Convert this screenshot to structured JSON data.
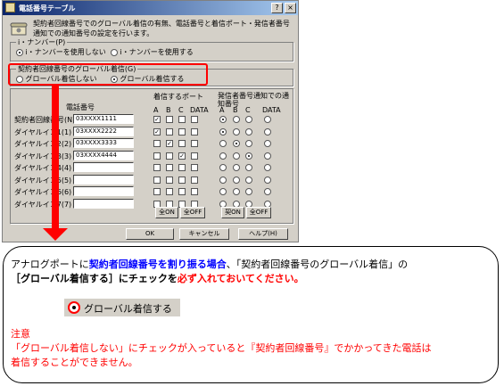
{
  "window": {
    "title": "電話番号テーブル",
    "description": "契約者回線番号でのグローバル着信の有無、電話番号と着信ポート・発信者番号通知での通知番号の設定を行います。",
    "inumber_group": {
      "label": "i・ナンバー(P)",
      "options": [
        "i・ナンバーを使用しない",
        "i・ナンバーを使用する"
      ],
      "selected": 0
    },
    "global_group": {
      "label": "契約者回線番号のグローバル着信(G)",
      "options": [
        "グローバル着信しない",
        "グローバル着信する"
      ],
      "selected": 1
    },
    "table": {
      "col_number": "電話番号",
      "col_ports": "着信するポート",
      "col_notify": "発信者番号通知での通知番号",
      "port_letters": [
        "A",
        "B",
        "C",
        "DATA"
      ],
      "rows": [
        {
          "label": "契約者回線番号(N)",
          "number": "03XXXX1111",
          "ports": [
            true,
            false,
            false,
            false
          ],
          "notify": 0
        },
        {
          "label": "ダイヤルイン1(1)",
          "number": "03XXXX2222",
          "ports": [
            true,
            false,
            false,
            false
          ],
          "notify": 0
        },
        {
          "label": "ダイヤルイン2(2)",
          "number": "03XXXX3333",
          "ports": [
            false,
            true,
            false,
            false
          ],
          "notify": 1
        },
        {
          "label": "ダイヤルイン3(3)",
          "number": "03XXXX4444",
          "ports": [
            false,
            false,
            true,
            false
          ],
          "notify": 2
        },
        {
          "label": "ダイヤルイン4(4)",
          "number": "",
          "ports": [
            false,
            false,
            false,
            false
          ],
          "notify": -1
        },
        {
          "label": "ダイヤルイン5(5)",
          "number": "",
          "ports": [
            false,
            false,
            false,
            false
          ],
          "notify": -1
        },
        {
          "label": "ダイヤルイン6(6)",
          "number": "",
          "ports": [
            false,
            false,
            false,
            false
          ],
          "notify": -1
        },
        {
          "label": "ダイヤルイン7(7)",
          "number": "",
          "ports": [
            false,
            false,
            false,
            false
          ],
          "notify": -1
        }
      ],
      "all_on": "全ON",
      "all_off": "全OFF",
      "contract_on": "契ON",
      "all_off2": "全OFF"
    },
    "buttons": {
      "ok": "OK",
      "cancel": "キャンセル",
      "help": "ヘルプ(H)"
    }
  },
  "note": {
    "line1_pre": "アナログポートに",
    "line1_bold": "契約者回線番号を割り振る場合",
    "line1_post": "、「契約者回線番号のグローバル着信」の",
    "line2_bracket": "［グローバル着信する］にチェックを",
    "line2_red": "必ず入れておいてください。",
    "sample_label": "グローバル着信する",
    "caution_title": "注意",
    "caution_line1": "「グローバル着信しない」にチェックが入っていると『契約者回線番号』でかかってきた電話は",
    "caution_line2": "着信することができません。"
  },
  "colors": {
    "accent_red": "#ff0000",
    "accent_blue": "#0000ff",
    "titlebar": "#0a246a"
  }
}
